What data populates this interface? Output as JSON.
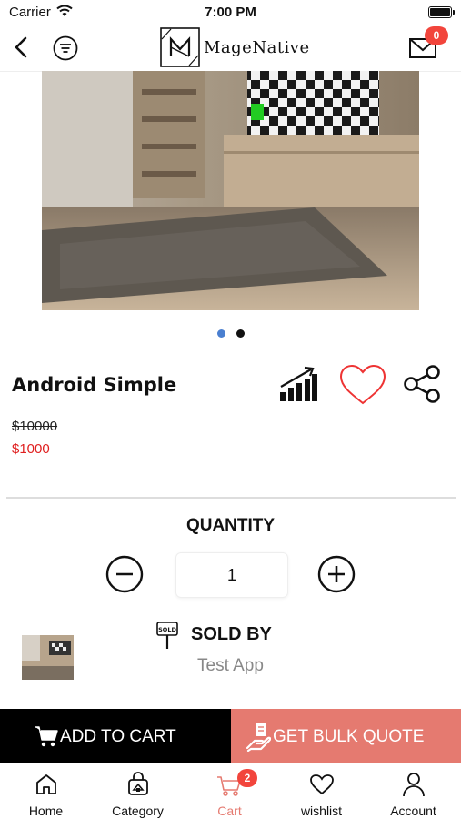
{
  "status_bar": {
    "carrier": "Carrier",
    "time": "7:00 PM"
  },
  "header": {
    "brand": "MageNative",
    "message_count": "0"
  },
  "product": {
    "name": "Android Simple",
    "old_price": "$10000",
    "price": "$1000",
    "image_count": 2,
    "active_image": 1
  },
  "quantity": {
    "title": "QUANTITY",
    "value": "1"
  },
  "seller": {
    "title": "SOLD BY",
    "name": "Test App"
  },
  "actions": {
    "add_to_cart": "ADD TO CART",
    "bulk_quote": "GET BULK QUOTE"
  },
  "tabs": [
    {
      "label": "Home",
      "icon": "home-icon"
    },
    {
      "label": "Category",
      "icon": "category-icon"
    },
    {
      "label": "Cart",
      "icon": "cart-icon",
      "badge": "2",
      "active": true
    },
    {
      "label": "wishlist",
      "icon": "heart-icon"
    },
    {
      "label": "Account",
      "icon": "account-icon"
    }
  ],
  "colors": {
    "accent": "#e57a70",
    "badge": "#f2453c",
    "price": "#e02020",
    "dot_active": "#4a7fd0"
  }
}
